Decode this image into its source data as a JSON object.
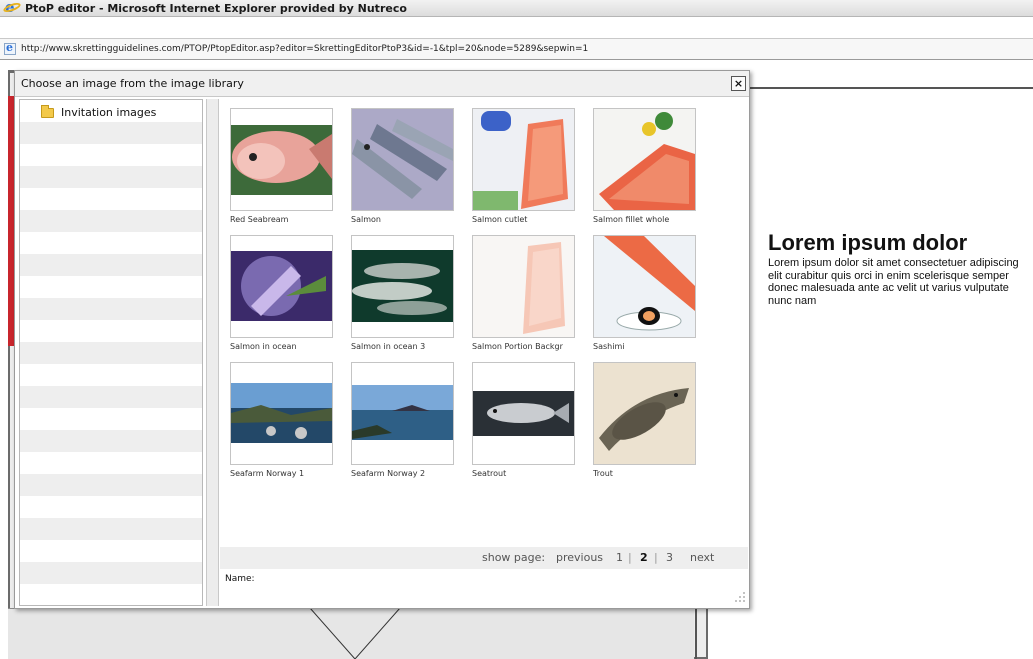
{
  "browser": {
    "title": "PtoP editor - Microsoft Internet Explorer provided by Nutreco",
    "url": "http://www.skrettingguidelines.com/PTOP/PtopEditor.asp?editor=SkrettingEditorPtoP3&id=-1&tpl=20&node=5289&sepwin=1",
    "icon": "ie-icon"
  },
  "background_page": {
    "heading": "Lorem ipsum dolor",
    "body": "Lorem ipsum dolor sit amet consectetuer adipiscing elit curabitur quis orci in enim scelerisque semper donec malesuada ante ac velit ut varius vulputate nunc nam"
  },
  "dialog": {
    "title": "Choose an image from the image library",
    "close_label": "×",
    "sidebar": {
      "items": [
        {
          "label": "Invitation images",
          "icon": "folder-icon"
        }
      ]
    },
    "images": [
      {
        "label": "Red Seabream"
      },
      {
        "label": "Salmon"
      },
      {
        "label": "Salmon cutlet"
      },
      {
        "label": "Salmon fillet whole"
      },
      {
        "label": "Salmon in ocean"
      },
      {
        "label": "Salmon in ocean 3"
      },
      {
        "label": "Salmon Portion Backgr"
      },
      {
        "label": "Sashimi"
      },
      {
        "label": "Seafarm Norway 1"
      },
      {
        "label": "Seafarm Norway 2"
      },
      {
        "label": "Seatrout"
      },
      {
        "label": "Trout"
      }
    ],
    "pager": {
      "prefix": "show page:",
      "previous": "previous",
      "pages": [
        "1",
        "2",
        "3"
      ],
      "current": "2",
      "separator": "|",
      "next": "next"
    },
    "name_label": "Name:"
  }
}
